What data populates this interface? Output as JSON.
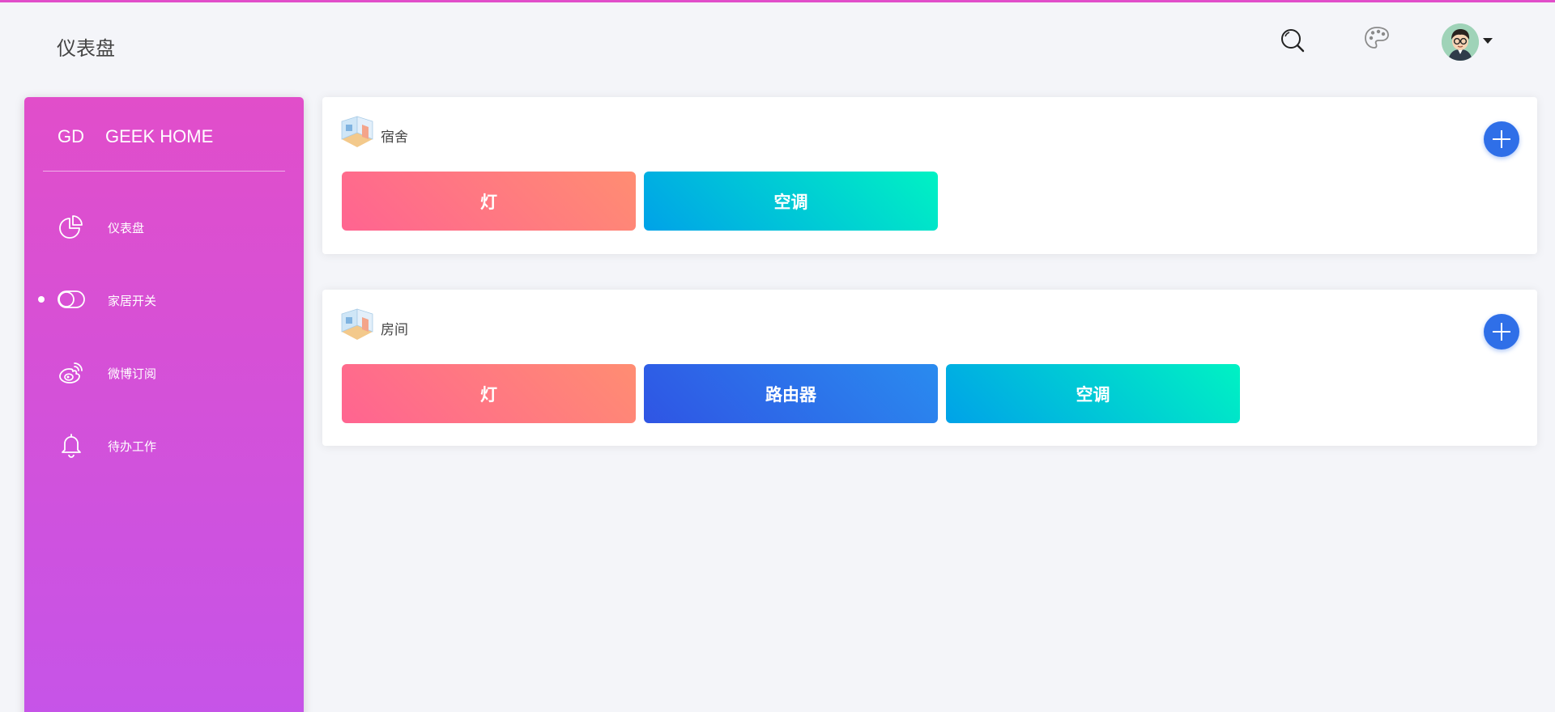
{
  "header": {
    "title": "仪表盘",
    "icons": [
      "search-icon",
      "palette-icon",
      "avatar",
      "caret-down-icon"
    ]
  },
  "sidebar": {
    "brand_mini": "GD",
    "brand_name": "GEEK HOME",
    "items": [
      {
        "label": "仪表盘",
        "icon": "pie-chart-icon",
        "active": false
      },
      {
        "label": "家居开关",
        "icon": "toggle-icon",
        "active": true
      },
      {
        "label": "微博订阅",
        "icon": "weibo-icon",
        "active": false
      },
      {
        "label": "待办工作",
        "icon": "bell-icon",
        "active": false
      }
    ]
  },
  "rooms": [
    {
      "name": "宿舍",
      "devices": [
        {
          "label": "灯",
          "style": "light"
        },
        {
          "label": "空调",
          "style": "ac"
        }
      ]
    },
    {
      "name": "房间",
      "devices": [
        {
          "label": "灯",
          "style": "light"
        },
        {
          "label": "路由器",
          "style": "router"
        },
        {
          "label": "空调",
          "style": "ac"
        }
      ]
    }
  ],
  "colors": {
    "accent": "#e14eca",
    "sidebar_top": "#e14eca",
    "sidebar_bottom": "#c654e8",
    "add_button": "#2f6fe8",
    "background": "#f4f5f9"
  }
}
